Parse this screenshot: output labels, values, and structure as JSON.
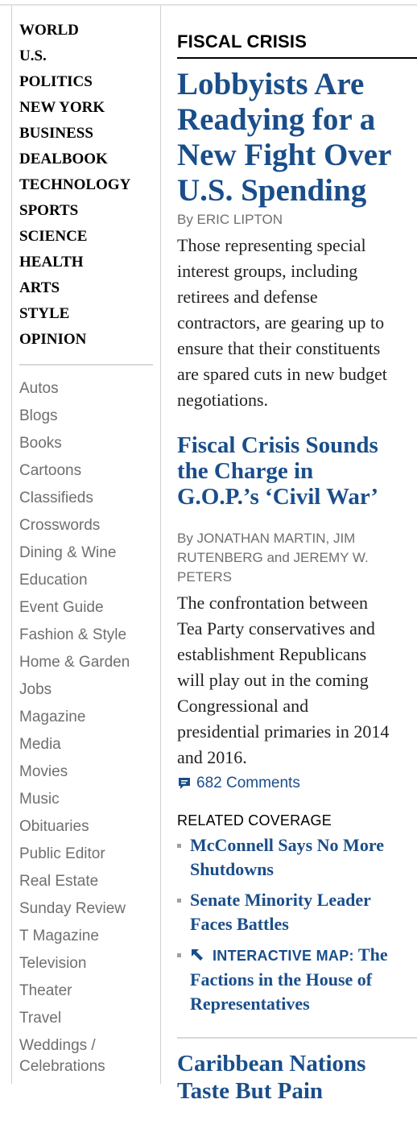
{
  "sidebar": {
    "sections": [
      "WORLD",
      "U.S.",
      "POLITICS",
      "NEW YORK",
      "BUSINESS",
      "DEALBOOK",
      "TECHNOLOGY",
      "SPORTS",
      "SCIENCE",
      "HEALTH",
      "ARTS",
      "STYLE",
      "OPINION"
    ],
    "more": [
      "Autos",
      "Blogs",
      "Books",
      "Cartoons",
      "Classifieds",
      "Crosswords",
      "Dining & Wine",
      "Education",
      "Event Guide",
      "Fashion & Style",
      "Home & Garden",
      "Jobs",
      "Magazine",
      "Media",
      "Movies",
      "Music",
      "Obituaries",
      "Public Editor",
      "Real Estate",
      "Sunday Review",
      "T Magazine",
      "Television",
      "Theater",
      "Travel"
    ],
    "last_item": [
      "Weddings /",
      "Celebrations"
    ]
  },
  "main": {
    "kicker": "FISCAL CRISIS",
    "lead": {
      "headline_lines": [
        "Lobbyists Are",
        "Readying for a",
        "New Fight Over",
        "U.S. Spending"
      ],
      "byline": "By ERIC LIPTON",
      "summary_lines": [
        "Those representing special",
        "interest groups, including",
        "retirees and defense",
        "contractors, are gearing up to",
        "ensure that their constituents",
        "are spared cuts in new budget",
        "negotiations."
      ]
    },
    "second": {
      "headline_lines": [
        "Fiscal Crisis Sounds",
        "the Charge in",
        "G.O.P.’s ‘Civil War’"
      ],
      "byline_lines": [
        "By JONATHAN MARTIN, JIM",
        "RUTENBERG and JEREMY W.",
        "PETERS"
      ],
      "summary_lines": [
        "The confrontation between",
        "Tea Party conservatives and",
        "establishment Republicans",
        "will play out in the coming",
        "Congressional and",
        "presidential primaries in 2014",
        "and 2016."
      ],
      "comments": "682 Comments"
    },
    "related": {
      "label": "RELATED COVERAGE",
      "items": [
        {
          "lines": [
            "McConnell Says No More",
            "Shutdowns"
          ]
        },
        {
          "lines": [
            "Senate Minority Leader",
            "Faces Battles"
          ]
        }
      ],
      "interactive": {
        "prefix": "INTERACTIVE MAP:",
        "title_first": "The",
        "lines": [
          "Factions in the House of",
          "Representatives"
        ]
      }
    },
    "third": {
      "headline_lines": [
        "Caribbean Nations",
        "Taste But Pain"
      ]
    }
  },
  "colors": {
    "headline_blue": "#1a4e8a",
    "gray_text": "#6f6f6f",
    "divider": "#d8d8d8"
  }
}
